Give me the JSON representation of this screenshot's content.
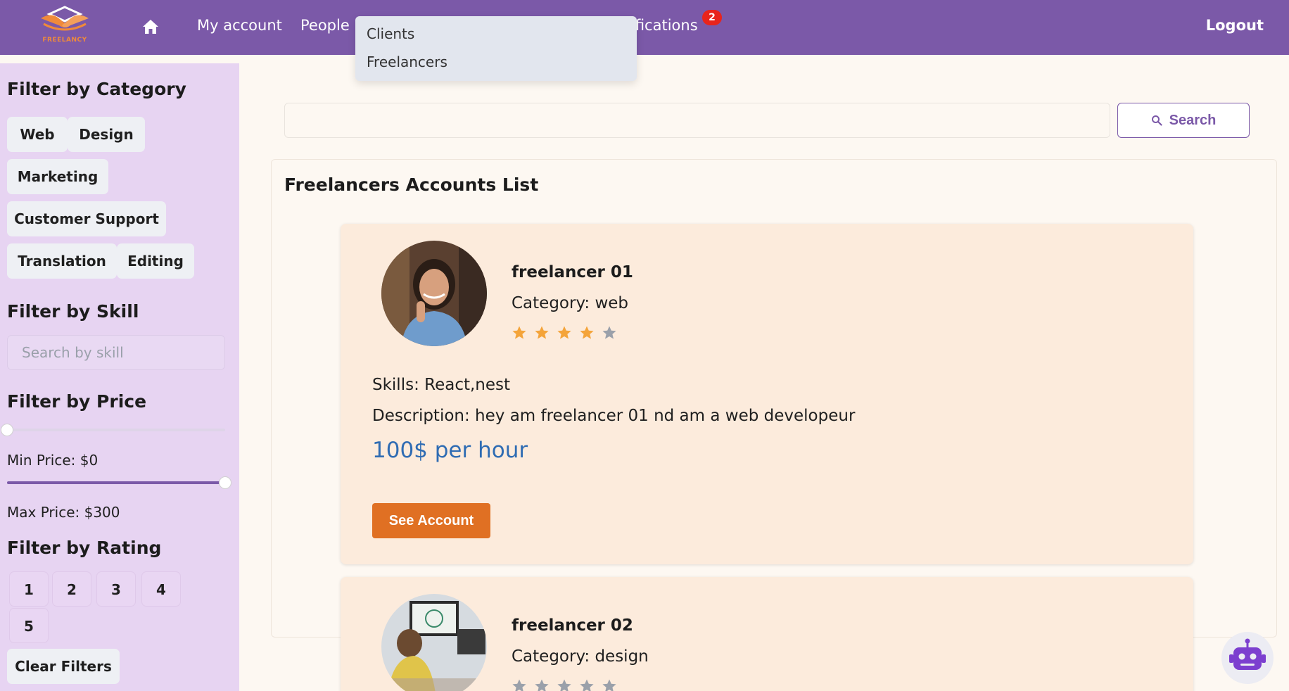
{
  "nav": {
    "logo_text": "FREELANCY",
    "links": [
      "My account",
      "People"
    ],
    "notifications_label": "ifications",
    "notifications_badge": "2",
    "logout": "Logout",
    "people_dropdown": [
      "Clients",
      "Freelancers"
    ]
  },
  "sidebar": {
    "category_heading": "Filter by Category",
    "categories": [
      "Web",
      "Design",
      "Marketing",
      "Customer Support",
      "Translation",
      "Editing"
    ],
    "skill_heading": "Filter by Skill",
    "skill_placeholder": "Search by skill",
    "price_heading": "Filter by Price",
    "min_price_label": "Min Price: $0",
    "max_price_label": "Max Price: $300",
    "min_price_value": 0,
    "max_price_value": 300,
    "price_range_max": 300,
    "rating_heading": "Filter by Rating",
    "ratings": [
      "1",
      "2",
      "3",
      "4",
      "5"
    ],
    "clear_filters": "Clear Filters"
  },
  "search": {
    "value": "",
    "button_label": "Search"
  },
  "list": {
    "title": "Freelancers Accounts List",
    "freelancers": [
      {
        "name": "freelancer 01",
        "category": "Category: web",
        "rating": 4,
        "skills": "Skills: React,nest",
        "description": "Description: hey am freelancer 01 nd am a web developeur",
        "price": "100$ per hour",
        "button": "See Account"
      },
      {
        "name": "freelancer 02",
        "category": "Category: design",
        "rating": 0
      }
    ]
  },
  "colors": {
    "navbar": "#7b59a8",
    "sidebar": "#e7d4f2",
    "accent_orange": "#e07023",
    "price_blue": "#2f6cb3",
    "star_filled": "#f4a43a",
    "star_empty": "#9aa0aa",
    "badge": "#e8241c"
  },
  "icons": {
    "home": "home-icon",
    "search": "search-icon",
    "chatbot": "robot-icon",
    "star": "star-icon"
  }
}
